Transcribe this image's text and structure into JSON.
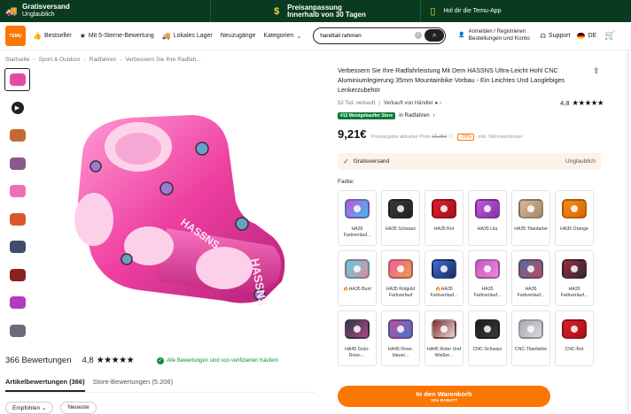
{
  "topbar": {
    "left_title": "Gratisversand",
    "left_sub": "Unglaublich",
    "mid_title": "Preisanpassung",
    "mid_sub": "Innerhalb von 30 Tagen",
    "right": "Hol dir die Temu-App"
  },
  "nav": {
    "logo": "Temu",
    "items": [
      "Bestseller",
      "Mit 5-Sterne-Bewertung",
      "Lokales Lager",
      "Neuzugänge",
      "Kategorien"
    ],
    "search_value": "handtail rahmen",
    "account_line1": "Anmelden / Registrieren",
    "account_line2": "Bestellungen und Konto",
    "support": "Support",
    "lang": "DE"
  },
  "breadcrumbs": [
    "Startseite",
    "Sport & Outdoor",
    "Radfahren",
    "Verbessern Sie Ihre Radfah..."
  ],
  "thumbs": [
    {
      "icon": "product-photo",
      "color": "#e24aa9",
      "selected": true
    },
    {
      "icon": "play-icon",
      "video": true
    },
    {
      "icon": "product-photo",
      "color": "#c56a34"
    },
    {
      "icon": "product-photo",
      "color": "#8a5a8c"
    },
    {
      "icon": "product-photo",
      "color": "#ef6fb6"
    },
    {
      "icon": "product-photo",
      "color": "#d9572a"
    },
    {
      "icon": "product-photo",
      "color": "#3f4c6b"
    },
    {
      "icon": "product-photo",
      "color": "#8b2020"
    },
    {
      "icon": "product-photo",
      "color": "#b43bc0"
    },
    {
      "icon": "product-photo",
      "color": "#6a6d79"
    }
  ],
  "main_image": {
    "brand_mark": "HASSNS",
    "color": "#f05bb0"
  },
  "reviews": {
    "count": "366 Bewertungen",
    "rating": "4,8",
    "stars": "★★★★★",
    "verified": "Alle Bewertungen sind von verifizierten Käufern",
    "tab_items": "Artikelbewertungen (366)",
    "tab_store": "Store-Bewertungen (5.206)",
    "filter_1": "Empfohlen",
    "filter_2": "Neueste"
  },
  "product": {
    "title": "Verbessern Sie Ihre Radfahrleistung Mit Dem HASSNS Ultra-Leicht Hohl CNC Aluminiumlegierung 35mm Mountainbike Vorbau - Ein Leichtes Und Langlebiges Lenkerzubehör",
    "sold": "52 Tsd. verkauft",
    "seller": "Verkauft von Händler",
    "rating": "4,8",
    "stars": "★★★★★",
    "badge": "#12 Meistgekaufter Store",
    "badge_suffix": "in Radfahren",
    "price": "9,21€",
    "price_note_prefix": "Preisangabe aktueller Preis",
    "old_price": "15,25€",
    "discount": "-39%",
    "price_note_suffix": "inkl. Mehrwertsteuer",
    "shipping": "Gratisversand",
    "shipping_right": "Unglaublich",
    "color_label": "Farbe:"
  },
  "colors": [
    {
      "label": "HA35 Farbverlauf...",
      "c1": "#c84fe0",
      "c2": "#3ac0e8"
    },
    {
      "label": "HA35 Schwarz",
      "c1": "#3a3a3a",
      "c2": "#202020"
    },
    {
      "label": "HA35 Rot",
      "c1": "#e0202c",
      "c2": "#a1121b"
    },
    {
      "label": "HA35 Lila",
      "c1": "#c05ad8",
      "c2": "#8a2fb0"
    },
    {
      "label": "HA35 Titanfarbe",
      "c1": "#d6b89a",
      "c2": "#a88a6a"
    },
    {
      "label": "HA35 Orange",
      "c1": "#f58a1a",
      "c2": "#d86a00"
    },
    {
      "label": "🔥HA35 Bunt",
      "c1": "#5acfe0",
      "c2": "#e08aa0"
    },
    {
      "label": "HA35 Rotgold Farbverlauf",
      "c1": "#f35aa8",
      "c2": "#e8a040"
    },
    {
      "label": "🔥HA35 Farbverlauf...",
      "c1": "#3a6ed8",
      "c2": "#1c2c58"
    },
    {
      "label": "HA35 Farbverlauf...",
      "c1": "#c25ac8",
      "c2": "#ee88d8"
    },
    {
      "label": "HA35 Farbverlauf...",
      "c1": "#4a6fa8",
      "c2": "#c04a5a"
    },
    {
      "label": "HA35 Farbverlauf...",
      "c1": "#9c2e3a",
      "c2": "#2a2a3a"
    },
    {
      "label": "HA45 Grün-Rose-...",
      "c1": "#2a3a4a",
      "c2": "#b04a8a"
    },
    {
      "label": "HA45 Rose-blauer...",
      "c1": "#c84a9a",
      "c2": "#3a7ad0"
    },
    {
      "label": "HA45 Roter Und Weißer...",
      "c1": "#8a2a2a",
      "c2": "#e0dcdc"
    },
    {
      "label": "CNC-Schwarz",
      "c1": "#1e1e1e",
      "c2": "#3a3a3a"
    },
    {
      "label": "CNC-Titanfarbe",
      "c1": "#a9acb2",
      "c2": "#d8d8dc"
    },
    {
      "label": "CNC-Rot",
      "c1": "#d8202a",
      "c2": "#a81018"
    }
  ],
  "cart": {
    "label": "In den Warenkorb",
    "sub": "10% RABATT"
  }
}
